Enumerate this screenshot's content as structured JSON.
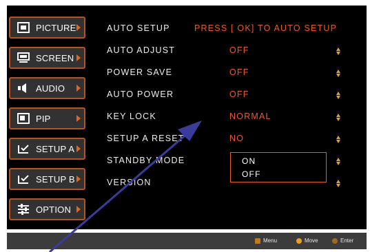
{
  "sidebar": {
    "items": [
      {
        "label": "PICTURE",
        "icon": "picture-icon"
      },
      {
        "label": "SCREEN",
        "icon": "screen-icon"
      },
      {
        "label": "AUDIO",
        "icon": "audio-icon"
      },
      {
        "label": "PIP",
        "icon": "pip-icon"
      },
      {
        "label": "SETUP A",
        "icon": "setup-a-icon"
      },
      {
        "label": "SETUP B",
        "icon": "setup-b-icon"
      },
      {
        "label": "OPTION",
        "icon": "option-icon"
      }
    ]
  },
  "settings": {
    "rows": [
      {
        "label": "AUTO SETUP",
        "value": "PRESS [ OK]  TO AUTO SETUP"
      },
      {
        "label": "AUTO ADJUST",
        "value": "OFF"
      },
      {
        "label": "POWER SAVE",
        "value": "OFF"
      },
      {
        "label": "AUTO POWER",
        "value": "OFF"
      },
      {
        "label": "KEY LOCK",
        "value": "NORMAL"
      },
      {
        "label": "SETUP A RESET",
        "value": "NO"
      },
      {
        "label": "STANDBY MODE",
        "value": ""
      },
      {
        "label": "VERSION",
        "value": ""
      }
    ],
    "dropdown_options": [
      "ON",
      "OFF"
    ]
  },
  "footer": {
    "menu_label": "Menu",
    "move_label": "Move",
    "enter_label": "Enter"
  },
  "colors": {
    "accent": "#ec5a2c",
    "button_border": "#b7531c",
    "arrow": "#f0a020",
    "pointer": "#3b3b9c"
  }
}
